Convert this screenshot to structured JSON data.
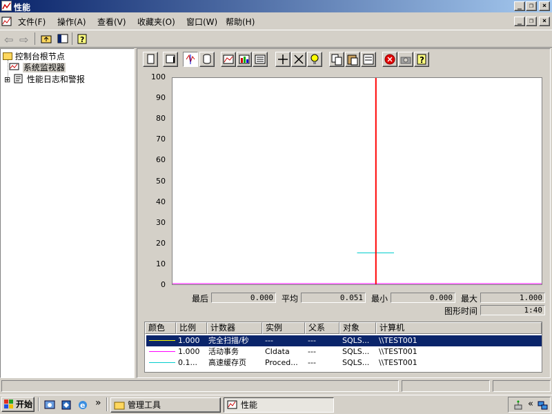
{
  "window": {
    "title": "性能"
  },
  "menu": [
    "文件(F)",
    "操作(A)",
    "查看(V)",
    "收藏夹(O)",
    "窗口(W)",
    "帮助(H)"
  ],
  "tree": {
    "root": "控制台根节点",
    "items": [
      "系统监视器",
      "性能日志和警报"
    ],
    "expander": "⊞"
  },
  "chart_data": {
    "type": "line",
    "y_ticks": [
      "100",
      "90",
      "80",
      "70",
      "60",
      "50",
      "40",
      "30",
      "20",
      "10",
      "0"
    ],
    "ylim": [
      0,
      100
    ],
    "series": [
      {
        "name": "完全扫描/秒",
        "color": "#ffff00",
        "values": [
          0,
          0,
          0,
          0,
          0,
          0,
          0,
          0,
          0,
          0
        ]
      },
      {
        "name": "活动事务",
        "color": "#ff00ff",
        "values": [
          0,
          0,
          0,
          0,
          0,
          0,
          0,
          0,
          0,
          0
        ]
      },
      {
        "name": "高速缓存页",
        "color": "#00cccc",
        "values": [
          null,
          null,
          null,
          null,
          null,
          15,
          null,
          null,
          null,
          null
        ]
      }
    ],
    "grid": false
  },
  "stats": {
    "last_label": "最后",
    "last_value": "0.000",
    "avg_label": "平均",
    "avg_value": "0.051",
    "min_label": "最小",
    "min_value": "0.000",
    "max_label": "最大",
    "max_value": "1.000",
    "time_label": "图形时间",
    "time_value": "1:40"
  },
  "legend": {
    "headers": [
      "颜色",
      "比例",
      "计数器",
      "实例",
      "父系",
      "对象",
      "计算机"
    ],
    "rows": [
      {
        "color": "#ffff00",
        "scale": "1.000",
        "counter": "完全扫描/秒",
        "instance": "---",
        "parent": "---",
        "object": "SQLS...",
        "computer": "\\\\TEST001"
      },
      {
        "color": "#ff00ff",
        "scale": "1.000",
        "counter": "活动事务",
        "instance": "CIdata",
        "parent": "---",
        "object": "SQLS...",
        "computer": "\\\\TEST001"
      },
      {
        "color": "#00cccc",
        "scale": "0.1...",
        "counter": "高速缓存页",
        "instance": "Proced...",
        "parent": "---",
        "object": "SQLS...",
        "computer": "\\\\TEST001"
      }
    ]
  },
  "taskbar": {
    "start": "开始",
    "chevron": "»",
    "tasks": [
      "管理工具",
      "性能"
    ],
    "tray_chevron": "«"
  }
}
